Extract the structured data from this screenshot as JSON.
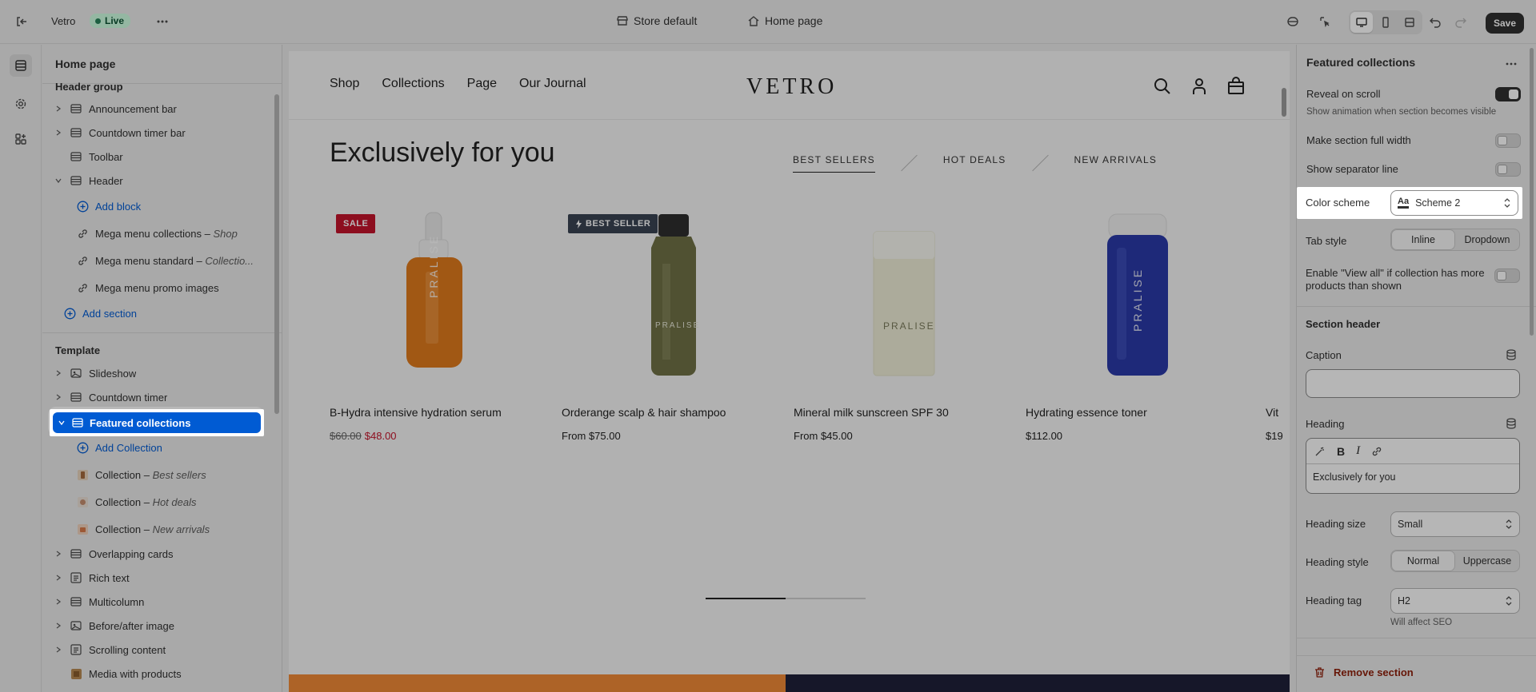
{
  "topbar": {
    "app_name": "Vetro",
    "live_badge": "Live",
    "store_label": "Store default",
    "page_label": "Home page",
    "save_label": "Save"
  },
  "sidebar": {
    "title": "Home page",
    "header_group_label": "Header group",
    "header_group": [
      {
        "label": "Announcement bar"
      },
      {
        "label": "Countdown timer bar"
      },
      {
        "label": "Toolbar"
      },
      {
        "label": "Header"
      }
    ],
    "add_block": "Add block",
    "menu_blocks": [
      {
        "label": "Mega menu collections",
        "sub": "Shop"
      },
      {
        "label": "Mega menu standard",
        "sub": "Collectio..."
      },
      {
        "label": "Mega menu promo images",
        "sub": ""
      }
    ],
    "add_section": "Add section",
    "template_label": "Template",
    "template": [
      {
        "label": "Slideshow"
      },
      {
        "label": "Countdown timer"
      },
      {
        "label": "Featured collections"
      }
    ],
    "add_collection": "Add Collection",
    "collections": [
      {
        "label": "Collection",
        "sub": "Best sellers"
      },
      {
        "label": "Collection",
        "sub": "Hot deals"
      },
      {
        "label": "Collection",
        "sub": "New arrivals"
      }
    ],
    "template_rest": [
      {
        "label": "Overlapping cards"
      },
      {
        "label": "Rich text"
      },
      {
        "label": "Multicolumn"
      },
      {
        "label": "Before/after image"
      },
      {
        "label": "Scrolling content"
      },
      {
        "label": "Media with products"
      }
    ]
  },
  "preview": {
    "nav_links": [
      "Shop",
      "Collections",
      "Page",
      "Our Journal"
    ],
    "logo": "VETRO",
    "heading": "Exclusively for you",
    "tabs": [
      "BEST SELLERS",
      "HOT DEALS",
      "NEW ARRIVALS"
    ],
    "products": [
      {
        "name": "B-Hydra intensive hydration serum",
        "old_price": "$60.00",
        "price": "$48.00",
        "badge": "SALE",
        "bottle_color": "#e07a1c",
        "brand": "PRALISE"
      },
      {
        "name": "Orderange scalp & hair shampoo",
        "price": "From $75.00",
        "badge": "BEST SELLER",
        "bottle_color": "#6f7146",
        "brand": "PRALISE"
      },
      {
        "name": "Mineral milk sunscreen SPF 30",
        "price": "From $45.00",
        "bottle_color": "#efeed7",
        "brand": "PRALISE"
      },
      {
        "name": "Hydrating essence toner",
        "price": "$112.00",
        "bottle_color": "#2a3aa8",
        "brand": "PRALISE"
      },
      {
        "name": "Vit",
        "price": "$19"
      }
    ]
  },
  "panel": {
    "title": "Featured collections",
    "reveal_label": "Reveal on scroll",
    "reveal_help": "Show animation when section becomes visible",
    "full_width_label": "Make section full width",
    "separator_label": "Show separator line",
    "color_scheme_label": "Color scheme",
    "color_scheme_value": "Scheme 2",
    "color_scheme_glyph": "Aa",
    "tab_style_label": "Tab style",
    "tab_style_options": [
      "Inline",
      "Dropdown"
    ],
    "view_all_label": "Enable \"View all\" if collection has more products than shown",
    "section_header_label": "Section header",
    "caption_label": "Caption",
    "heading_label": "Heading",
    "heading_value": "Exclusively for you",
    "heading_size_label": "Heading size",
    "heading_size_value": "Small",
    "heading_style_label": "Heading style",
    "heading_style_options": [
      "Normal",
      "Uppercase"
    ],
    "heading_tag_label": "Heading tag",
    "heading_tag_value": "H2",
    "heading_tag_help": "Will affect SEO",
    "remove_label": "Remove section"
  },
  "colors": {
    "accent": "#005bd3",
    "critical": "#8e1f0b",
    "sale": "#c4142c"
  }
}
